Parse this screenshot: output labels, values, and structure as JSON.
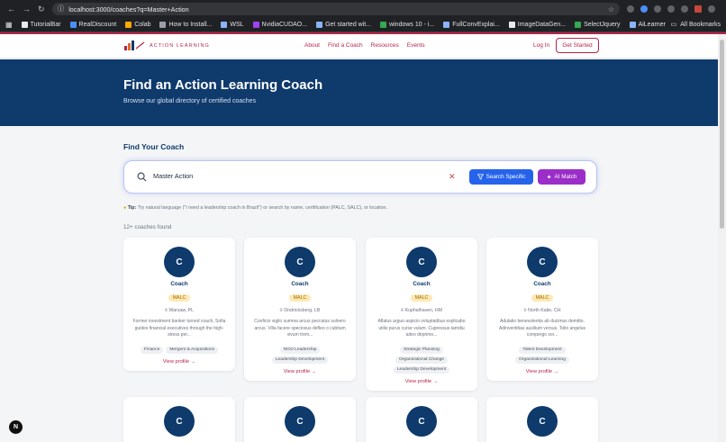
{
  "browser": {
    "url": "localhost:3000/coaches?q=Master+Action",
    "bookmarks": [
      "TutorialBar",
      "RealDiscount",
      "Colab",
      "How to Install...",
      "WSL",
      "NvidiaCUDAO...",
      "Get started wit...",
      "windows 10 - i...",
      "FullConvExplai...",
      "ImageDataGen...",
      "SelectJquery",
      "AiLearner"
    ],
    "all_bookmarks": "All Bookmarks"
  },
  "header": {
    "logo_text": "ACTION LEARNING",
    "nav": [
      "About",
      "Find a Coach",
      "Resources",
      "Events"
    ],
    "login": "Log In",
    "cta": "Get Started"
  },
  "hero": {
    "title": "Find an Action Learning Coach",
    "subtitle": "Browse our global directory of certified coaches"
  },
  "search": {
    "section_title": "Find Your Coach",
    "query": "Master Action",
    "clear": "✕",
    "btn_specific": "Search Specific",
    "btn_match": "AI Match",
    "tip_label": "Tip:",
    "tip_text": "Try natural language (\"I need a leadership coach in Brazil\") or search by name, certification (PALC, SALC), or location.",
    "results_count": "12+ coaches found"
  },
  "coaches": [
    {
      "initial": "C",
      "name": "Coach",
      "cert": "MALC",
      "location": "Warsaw, PL",
      "description": "Former investment banker turned coach, Sofia guides financial executives through the high-stress per...",
      "tags": [
        "Finance",
        "Mergers & Acquisitions"
      ],
      "link": "View profile →"
    },
    {
      "initial": "C",
      "name": "Coach",
      "cert": "MALC",
      "location": "Ondricksberg, LB",
      "description": "Conficio vigilo summa arcus peccatus vulnero arcus. Villa facere speciosus defleo o cubitum vivum trem...",
      "tags": [
        "NGO Leadership",
        "Leadership Development"
      ],
      "link": "View profile →"
    },
    {
      "initial": "C",
      "name": "Coach",
      "cert": "MALC",
      "location": "Kuphalhaven, HM",
      "description": "Aflatus arguo aspicio voluptatibus explicabo utilis purus curse vulum. Cupressus tamdiu adeo deprimo...",
      "tags": [
        "Strategic Planning",
        "Organizational Change",
        "Leadership Development"
      ],
      "link": "View profile →"
    },
    {
      "initial": "C",
      "name": "Coach",
      "cert": "MALC",
      "location": "North Katie, CH",
      "description": "Adulatio benevolentia ab ducimus demitto. Adinventitias auxilium versus. Tolio angelus compergo sor...",
      "tags": [
        "Talent Development",
        "Organizational Learning"
      ],
      "link": "View profile →"
    }
  ],
  "partial_initials": [
    "C",
    "C",
    "C",
    "C"
  ],
  "dev_badge": "N"
}
